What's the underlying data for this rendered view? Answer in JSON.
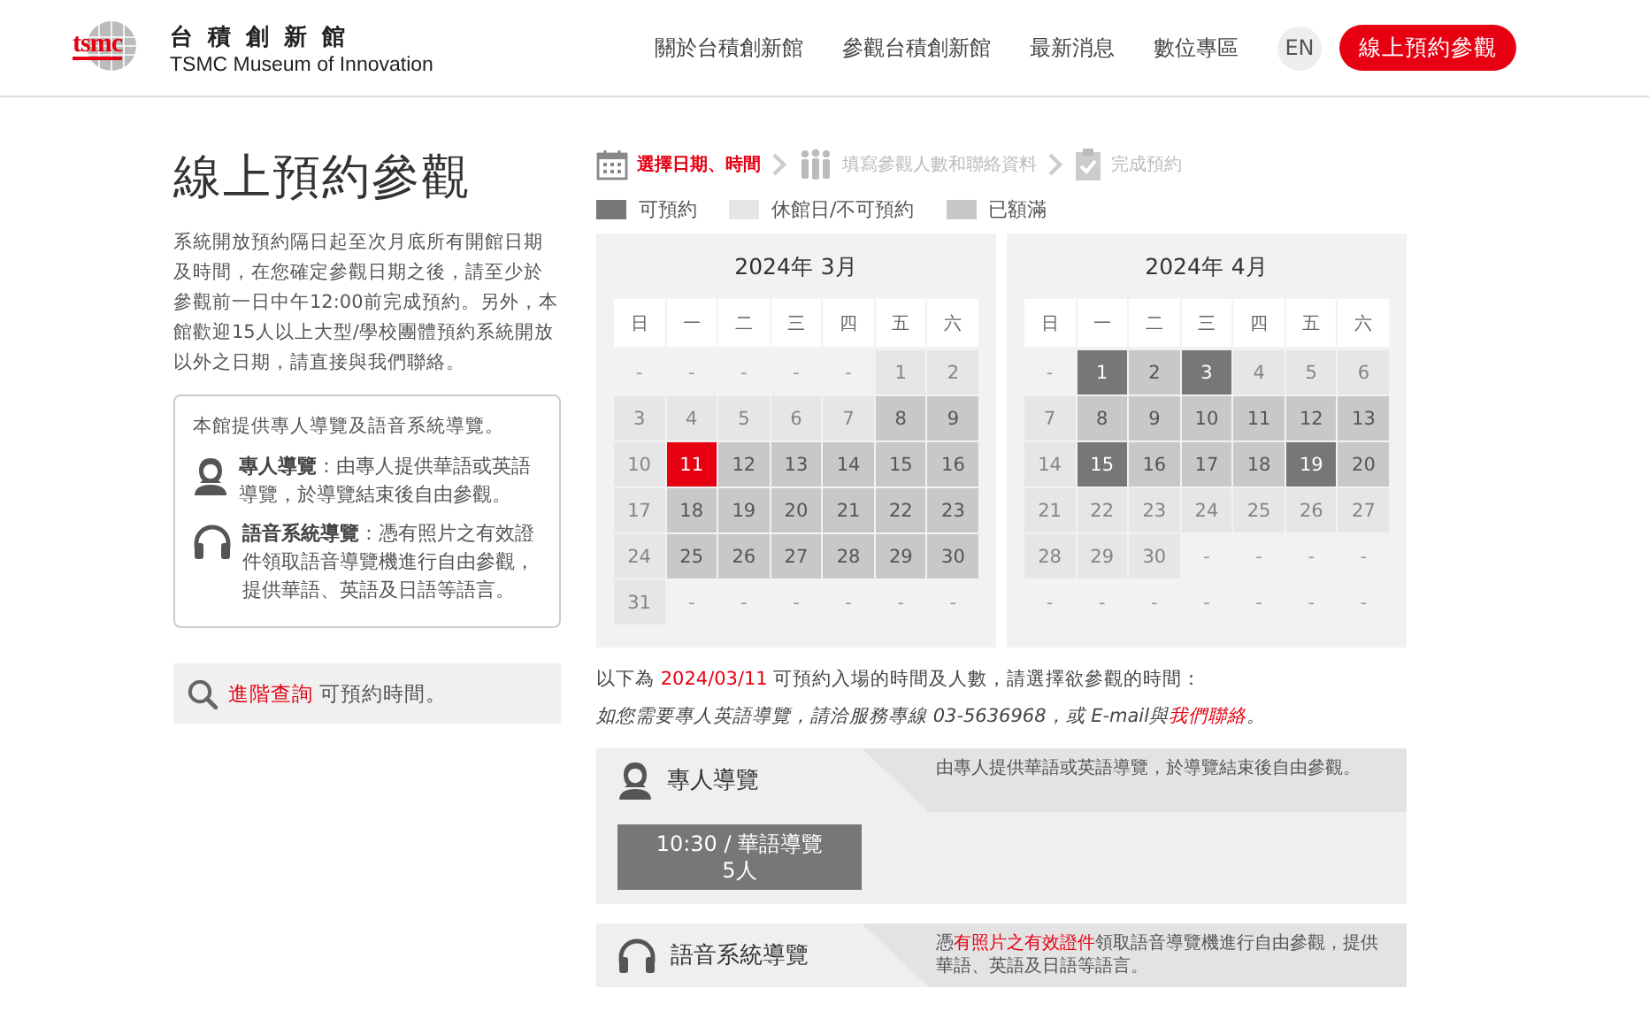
{
  "header": {
    "logo_text": "tsmc",
    "name_zh": "台 積 創 新 館",
    "name_en": "TSMC Museum of Innovation",
    "nav": [
      {
        "label": "關於台積創新館",
        "selected": false
      },
      {
        "label": "參觀台積創新館",
        "selected": false
      },
      {
        "label": "最新消息",
        "selected": false
      },
      {
        "label": "數位專區",
        "selected": false
      }
    ],
    "language": "EN",
    "cta": "線上預約參觀"
  },
  "sidebar": {
    "title": "線上預約參觀",
    "intro": "系統開放預約隔日起至次月底所有開館日期及時間，在您確定參觀日期之後，請至少於參觀前一日中午12:00前完成預約。另外，本館歡迎15人以上大型/學校團體預約系統開放以外之日期，請直接與我們聯絡。",
    "info": {
      "heading": "本館提供專人導覽及語音系統導覽。",
      "items": [
        {
          "kind": "guide",
          "title": "專人導覽",
          "text": "：由專人提供華語或英語導覽，於導覽結束後自由參觀。"
        },
        {
          "kind": "audio",
          "title": "語音系統導覽",
          "text": "：憑有照片之有效證件領取語音導覽機進行自由參觀，提供華語、英語及日語等語言。"
        }
      ]
    },
    "search": {
      "link": "進階查詢",
      "text": " 可預約時間。"
    }
  },
  "steps": [
    {
      "kind": "calendar",
      "label": "選擇日期、時間",
      "selected": true
    },
    {
      "kind": "people",
      "label": "填寫參觀人數和聯絡資料",
      "selected": false
    },
    {
      "kind": "done",
      "label": "完成預約",
      "selected": false
    }
  ],
  "legend": [
    {
      "label": "可預約",
      "color": "#777777"
    },
    {
      "label": "休館日/不可預約",
      "color": "#e6e6e6"
    },
    {
      "label": "已額滿",
      "color": "#c8c8c8"
    }
  ],
  "months": [
    {
      "title": "2024年 3月",
      "weekdays": [
        "日",
        "一",
        "二",
        "三",
        "四",
        "五",
        "六"
      ],
      "days": [
        {
          "d": "-",
          "kind": "blank",
          "selected": false
        },
        {
          "d": "-",
          "kind": "blank",
          "selected": false
        },
        {
          "d": "-",
          "kind": "blank",
          "selected": false
        },
        {
          "d": "-",
          "kind": "blank",
          "selected": false
        },
        {
          "d": "-",
          "kind": "blank",
          "selected": false
        },
        {
          "d": "1",
          "kind": "closed",
          "selected": false
        },
        {
          "d": "2",
          "kind": "closed",
          "selected": false
        },
        {
          "d": "3",
          "kind": "closed",
          "selected": false
        },
        {
          "d": "4",
          "kind": "closed",
          "selected": false
        },
        {
          "d": "5",
          "kind": "closed",
          "selected": false
        },
        {
          "d": "6",
          "kind": "closed",
          "selected": false
        },
        {
          "d": "7",
          "kind": "closed",
          "selected": false
        },
        {
          "d": "8",
          "kind": "full",
          "selected": false
        },
        {
          "d": "9",
          "kind": "full",
          "selected": false
        },
        {
          "d": "10",
          "kind": "closed",
          "selected": false
        },
        {
          "d": "11",
          "kind": "open",
          "selected": true
        },
        {
          "d": "12",
          "kind": "full",
          "selected": false
        },
        {
          "d": "13",
          "kind": "full",
          "selected": false
        },
        {
          "d": "14",
          "kind": "full",
          "selected": false
        },
        {
          "d": "15",
          "kind": "full",
          "selected": false
        },
        {
          "d": "16",
          "kind": "full",
          "selected": false
        },
        {
          "d": "17",
          "kind": "closed",
          "selected": false
        },
        {
          "d": "18",
          "kind": "full",
          "selected": false
        },
        {
          "d": "19",
          "kind": "full",
          "selected": false
        },
        {
          "d": "20",
          "kind": "full",
          "selected": false
        },
        {
          "d": "21",
          "kind": "full",
          "selected": false
        },
        {
          "d": "22",
          "kind": "full",
          "selected": false
        },
        {
          "d": "23",
          "kind": "full",
          "selected": false
        },
        {
          "d": "24",
          "kind": "closed",
          "selected": false
        },
        {
          "d": "25",
          "kind": "full",
          "selected": false
        },
        {
          "d": "26",
          "kind": "full",
          "selected": false
        },
        {
          "d": "27",
          "kind": "full",
          "selected": false
        },
        {
          "d": "28",
          "kind": "full",
          "selected": false
        },
        {
          "d": "29",
          "kind": "full",
          "selected": false
        },
        {
          "d": "30",
          "kind": "full",
          "selected": false
        },
        {
          "d": "31",
          "kind": "closed",
          "selected": false
        },
        {
          "d": "-",
          "kind": "blank",
          "selected": false
        },
        {
          "d": "-",
          "kind": "blank",
          "selected": false
        },
        {
          "d": "-",
          "kind": "blank",
          "selected": false
        },
        {
          "d": "-",
          "kind": "blank",
          "selected": false
        },
        {
          "d": "-",
          "kind": "blank",
          "selected": false
        },
        {
          "d": "-",
          "kind": "blank",
          "selected": false
        }
      ]
    },
    {
      "title": "2024年 4月",
      "weekdays": [
        "日",
        "一",
        "二",
        "三",
        "四",
        "五",
        "六"
      ],
      "days": [
        {
          "d": "-",
          "kind": "blank",
          "selected": false
        },
        {
          "d": "1",
          "kind": "open",
          "selected": false
        },
        {
          "d": "2",
          "kind": "full",
          "selected": false
        },
        {
          "d": "3",
          "kind": "open",
          "selected": false
        },
        {
          "d": "4",
          "kind": "closed",
          "selected": false
        },
        {
          "d": "5",
          "kind": "closed",
          "selected": false
        },
        {
          "d": "6",
          "kind": "closed",
          "selected": false
        },
        {
          "d": "7",
          "kind": "closed",
          "selected": false
        },
        {
          "d": "8",
          "kind": "full",
          "selected": false
        },
        {
          "d": "9",
          "kind": "full",
          "selected": false
        },
        {
          "d": "10",
          "kind": "full",
          "selected": false
        },
        {
          "d": "11",
          "kind": "full",
          "selected": false
        },
        {
          "d": "12",
          "kind": "full",
          "selected": false
        },
        {
          "d": "13",
          "kind": "full",
          "selected": false
        },
        {
          "d": "14",
          "kind": "closed",
          "selected": false
        },
        {
          "d": "15",
          "kind": "open",
          "selected": false
        },
        {
          "d": "16",
          "kind": "full",
          "selected": false
        },
        {
          "d": "17",
          "kind": "full",
          "selected": false
        },
        {
          "d": "18",
          "kind": "full",
          "selected": false
        },
        {
          "d": "19",
          "kind": "open",
          "selected": false
        },
        {
          "d": "20",
          "kind": "full",
          "selected": false
        },
        {
          "d": "21",
          "kind": "closed",
          "selected": false
        },
        {
          "d": "22",
          "kind": "closed",
          "selected": false
        },
        {
          "d": "23",
          "kind": "closed",
          "selected": false
        },
        {
          "d": "24",
          "kind": "closed",
          "selected": false
        },
        {
          "d": "25",
          "kind": "closed",
          "selected": false
        },
        {
          "d": "26",
          "kind": "closed",
          "selected": false
        },
        {
          "d": "27",
          "kind": "closed",
          "selected": false
        },
        {
          "d": "28",
          "kind": "closed",
          "selected": false
        },
        {
          "d": "29",
          "kind": "closed",
          "selected": false
        },
        {
          "d": "30",
          "kind": "closed",
          "selected": false
        },
        {
          "d": "-",
          "kind": "blank",
          "selected": false
        },
        {
          "d": "-",
          "kind": "blank",
          "selected": false
        },
        {
          "d": "-",
          "kind": "blank",
          "selected": false
        },
        {
          "d": "-",
          "kind": "blank",
          "selected": false
        },
        {
          "d": "-",
          "kind": "blank",
          "selected": false
        },
        {
          "d": "-",
          "kind": "blank",
          "selected": false
        },
        {
          "d": "-",
          "kind": "blank",
          "selected": false
        },
        {
          "d": "-",
          "kind": "blank",
          "selected": false
        },
        {
          "d": "-",
          "kind": "blank",
          "selected": false
        },
        {
          "d": "-",
          "kind": "blank",
          "selected": false
        },
        {
          "d": "-",
          "kind": "blank",
          "selected": false
        }
      ]
    }
  ],
  "notice": [
    {
      "kind": "text",
      "text": "以下為 "
    },
    {
      "kind": "highlight",
      "text": "2024/03/11"
    },
    {
      "kind": "text",
      "text": " 可預約入場的時間及人數，請選擇欲參觀的時間："
    }
  ],
  "contact": [
    {
      "kind": "text",
      "text": "如您需要專人英語導覽，請洽服務專線 03-5636968，或 E-mail與"
    },
    {
      "kind": "link",
      "text": "我們聯絡"
    },
    {
      "kind": "text",
      "text": "。"
    }
  ],
  "tours": [
    {
      "kind": "guide",
      "title": "專人導覽",
      "description": [
        {
          "kind": "text",
          "text": "由專人提供華語或英語導覽，於導覽結束後自由參觀。"
        }
      ],
      "slots": [
        {
          "time": "10:30 / 華語導覽",
          "count": "5人"
        }
      ]
    },
    {
      "kind": "audio",
      "title": "語音系統導覽",
      "description": [
        {
          "kind": "text",
          "text": "憑"
        },
        {
          "kind": "highlight",
          "text": "有照片之有效證件"
        },
        {
          "kind": "text",
          "text": "領取語音導覽機進行自由參觀，提供華語、英語及日語等語言。"
        }
      ]
    }
  ]
}
